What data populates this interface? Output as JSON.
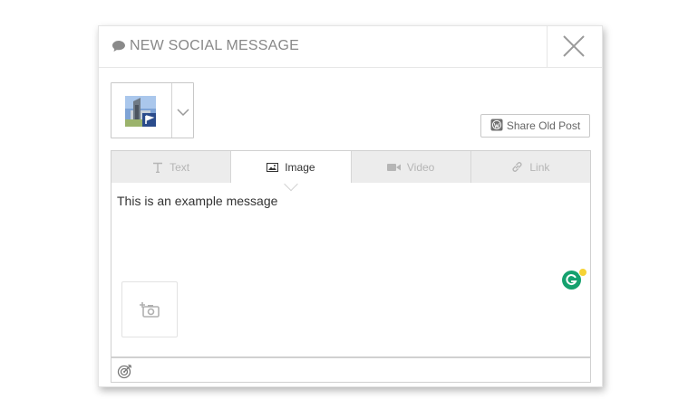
{
  "dialog": {
    "title": "NEW SOCIAL MESSAGE",
    "close_icon": "close-icon"
  },
  "profile_picker": {
    "avatar": "profile-avatar",
    "network_badge": "flag-icon",
    "dropdown_icon": "chevron-down-icon"
  },
  "toolbar": {
    "share_old_post_label": "Share Old Post",
    "share_old_post_icon": "wordpress-icon"
  },
  "tabs": [
    {
      "label": "Text",
      "icon": "text-icon",
      "active": false
    },
    {
      "label": "Image",
      "icon": "image-icon",
      "active": true
    },
    {
      "label": "Video",
      "icon": "video-icon",
      "active": false
    },
    {
      "label": "Link",
      "icon": "link-icon",
      "active": false
    }
  ],
  "editor": {
    "message": "This is an example message",
    "grammarly_icon": "grammarly-icon",
    "add_photo_icon": "add-photo-icon"
  },
  "footer": {
    "target_icon": "target-icon"
  },
  "colors": {
    "accent_green": "#15a16e",
    "notification_yellow": "#f6d335",
    "network_badge_blue": "#2b4c8c"
  }
}
